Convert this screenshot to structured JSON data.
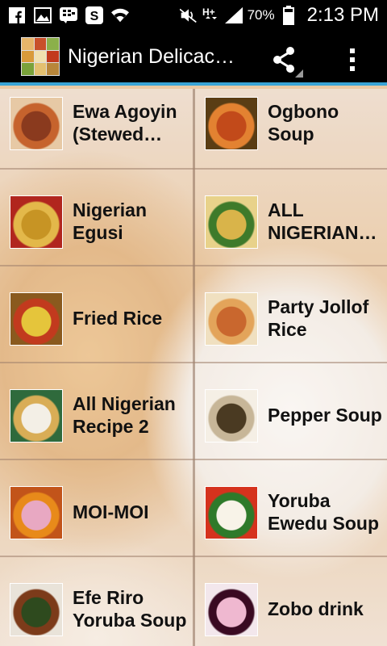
{
  "status_bar": {
    "battery_percent": "70%",
    "time": "2:13 PM",
    "icons": [
      "facebook-icon",
      "image-icon",
      "bbm-icon",
      "skype-icon",
      "wifi-icon",
      "mute-icon",
      "hplus-icon",
      "signal-icon",
      "battery-icon"
    ]
  },
  "action_bar": {
    "title": "Nigerian Delicac…",
    "share_icon": "share-icon",
    "overflow_icon": "overflow-menu-icon",
    "accent_color": "#39a4d6"
  },
  "recipes": [
    {
      "label": "Ewa Agoyin (Stewed…",
      "thumb_colors": [
        "#8a3a1e",
        "#c6632d",
        "#e7c9a5"
      ]
    },
    {
      "label": "Ogbono Soup (Draw…",
      "thumb_colors": [
        "#c24a1a",
        "#e38231",
        "#5a3d14"
      ]
    },
    {
      "label": "Nigerian Egusi Soup…",
      "thumb_colors": [
        "#c79424",
        "#e3b84a",
        "#b1261e"
      ]
    },
    {
      "label": "ALL NIGERIAN…",
      "thumb_colors": [
        "#d9b44a",
        "#3e7a2a",
        "#e8d28a"
      ]
    },
    {
      "label": "Fried Rice",
      "thumb_colors": [
        "#e5c53b",
        "#c23a1e",
        "#8a5a1e"
      ]
    },
    {
      "label": "Party Jollof Rice",
      "thumb_colors": [
        "#c9672e",
        "#e3a45a",
        "#f0e0c0"
      ]
    },
    {
      "label": "All Nigerian Recipe 2",
      "thumb_colors": [
        "#f3efe6",
        "#d9ad56",
        "#2f6a3c"
      ]
    },
    {
      "label": "Pepper Soup",
      "thumb_colors": [
        "#4a3a22",
        "#c7b698",
        "#f5efe5"
      ]
    },
    {
      "label": "MOI-MOI",
      "thumb_colors": [
        "#e8a8c2",
        "#e88a1a",
        "#c2541a"
      ]
    },
    {
      "label": "Yoruba Ewedu Soup",
      "thumb_colors": [
        "#f8f3e8",
        "#2e7a2a",
        "#d5321d"
      ]
    },
    {
      "label": "Efe Riro Yoruba Soup",
      "thumb_colors": [
        "#2e4a1e",
        "#7c3b1a",
        "#e9e3d9"
      ]
    },
    {
      "label": "Zobo drink",
      "thumb_colors": [
        "#efb8d0",
        "#3a0a22",
        "#f3e7ec"
      ]
    }
  ]
}
